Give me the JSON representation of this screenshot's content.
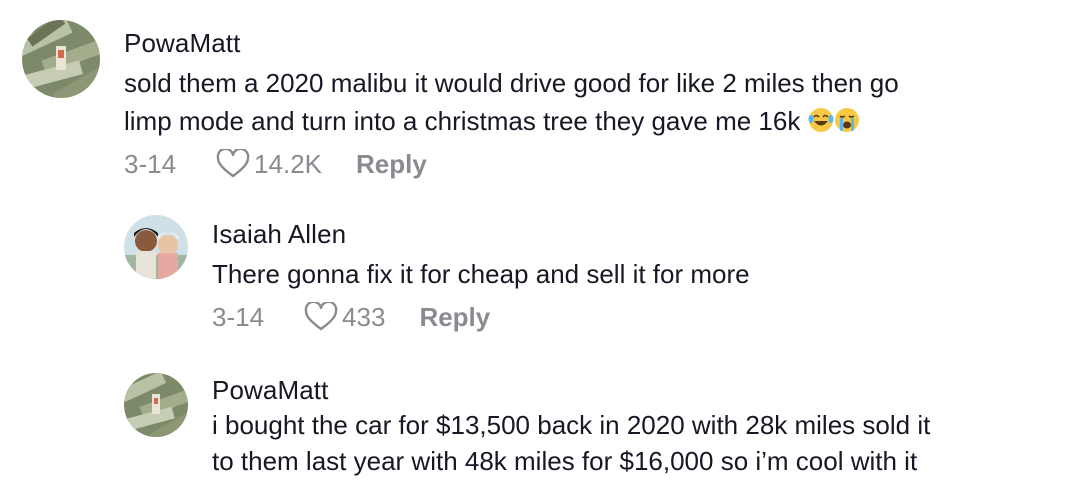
{
  "comments": [
    {
      "username": "PowaMatt",
      "text": "sold them a 2020 malibu it would drive good for like 2 miles then go\nlimp mode and turn into a christmas tree they gave me 16k",
      "emojis": [
        "laughing-tears-emoji",
        "crying-emoji"
      ],
      "date": "3-14",
      "likes": "14.2K",
      "reply_label": "Reply"
    },
    {
      "username": "Isaiah Allen",
      "text": "There gonna fix it for cheap and sell it for more",
      "date": "3-14",
      "likes": "433",
      "reply_label": "Reply"
    },
    {
      "username": "PowaMatt",
      "text": "i bought the car for $13,500 back in 2020 with 28k miles sold it\nto them last year with 48k miles for $16,000 so i’m cool with it"
    }
  ],
  "colors": {
    "text": "#161823",
    "meta": "#8a8b91"
  },
  "icons": {
    "like": "heart-outline-icon"
  }
}
